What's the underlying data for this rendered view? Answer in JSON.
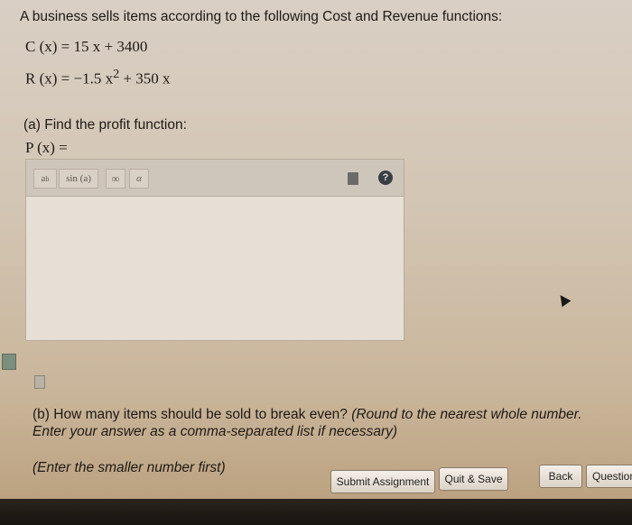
{
  "problem": {
    "intro": "A business sells items according to the following Cost and Revenue functions:",
    "cost_eq": "C (x) = 15 x + 3400",
    "revenue_eq_lhs": "R (x) = −1.5 x",
    "revenue_eq_exp": "2",
    "revenue_eq_rhs": " + 350 x"
  },
  "part_a": {
    "prompt": "(a) Find the profit function:",
    "profit_lhs": "P (x) ="
  },
  "editor": {
    "toolbar": {
      "power_base": "a",
      "power_exp": "b",
      "sin_label": "sin (a)",
      "infinity_label": "∞",
      "alpha_label": "α",
      "help_label": "?"
    },
    "value": ""
  },
  "part_b": {
    "prompt_plain": "(b) How many items should be sold to break even? ",
    "prompt_italic": "(Round to the nearest whole number.",
    "line2": "Enter your answer as a comma-separated list if necessary)",
    "line3": "(Enter the smaller number first)"
  },
  "buttons": {
    "submit": "Submit Assignment",
    "quit": "Quit & Save",
    "back": "Back",
    "question": "Question"
  },
  "icons": {
    "trash": "trash-icon",
    "help": "help-icon"
  }
}
